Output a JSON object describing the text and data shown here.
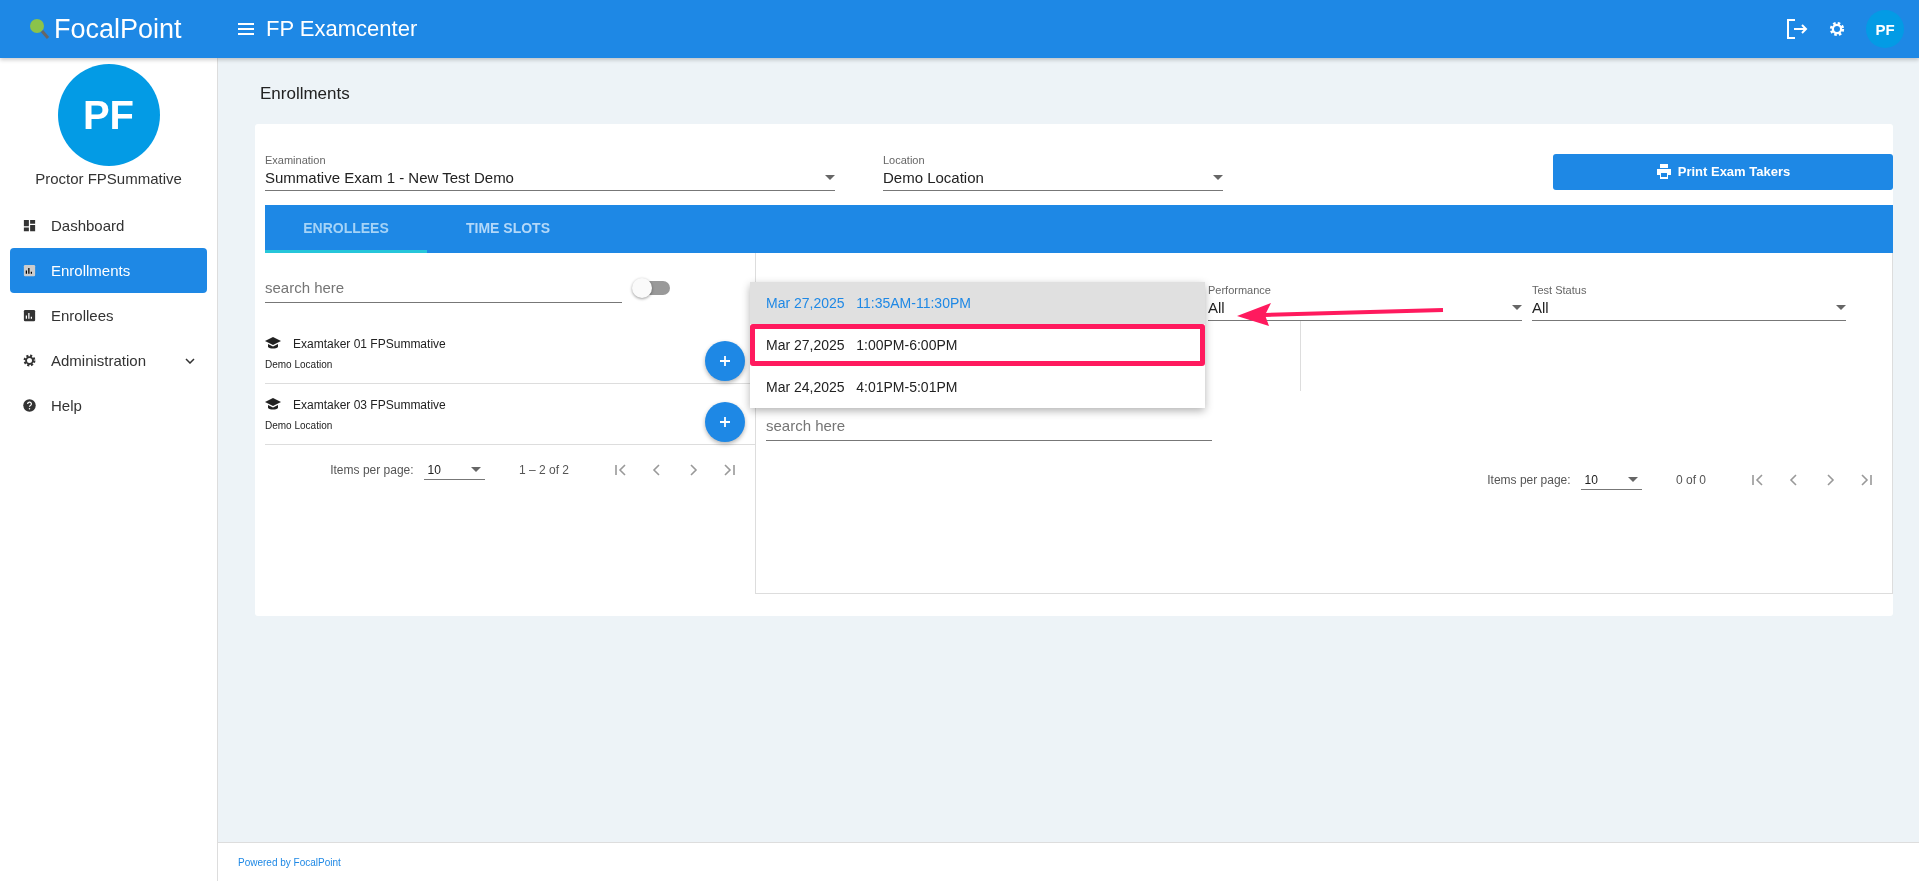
{
  "header": {
    "logo": "FocalPoint",
    "title": "FP Examcenter",
    "avatar": "PF"
  },
  "sidebar": {
    "avatar": "PF",
    "user": "Proctor FPSummative",
    "items": [
      {
        "label": "Dashboard",
        "selected": false,
        "expandable": false
      },
      {
        "label": "Enrollments",
        "selected": true,
        "expandable": false
      },
      {
        "label": "Enrollees",
        "selected": false,
        "expandable": false
      },
      {
        "label": "Administration",
        "selected": false,
        "expandable": true
      },
      {
        "label": "Help",
        "selected": false,
        "expandable": false
      }
    ]
  },
  "page_title": "Enrollments",
  "filters": [
    {
      "label": "Examination",
      "value": "Summative Exam 1 - New Test Demo"
    },
    {
      "label": "Location",
      "value": "Demo Location"
    }
  ],
  "print_button": "Print Exam Takers",
  "tabs": [
    {
      "label": "ENROLLEES",
      "selected": true
    },
    {
      "label": "TIME SLOTS",
      "selected": false
    }
  ],
  "enrollees": {
    "search": {
      "placeholder": "search here"
    },
    "toggle_on": false,
    "rows": [
      {
        "name": "Examtaker 01 FPSummative",
        "location": "Demo Location"
      },
      {
        "name": "Examtaker 03 FPSummative",
        "location": "Demo Location"
      }
    ],
    "paginator": {
      "label": "Items per page:",
      "size": "10",
      "range": "1 – 2 of 2"
    }
  },
  "time_slot_dropdown": {
    "options": [
      {
        "label": "Mar 27,2025   11:35AM-11:30PM",
        "selected": true,
        "highlighted": false
      },
      {
        "label": "Mar 27,2025   1:00PM-6:00PM",
        "selected": false,
        "highlighted": true
      },
      {
        "label": "Mar 24,2025   4:01PM-5:01PM",
        "selected": false,
        "highlighted": false
      }
    ]
  },
  "right_filters": [
    {
      "label": "Performance",
      "value": "All"
    },
    {
      "label": "Test Status",
      "value": "All"
    }
  ],
  "results": {
    "search": {
      "placeholder": "search here"
    },
    "paginator": {
      "label": "Items per page:",
      "size": "10",
      "range": "0 of 0"
    }
  },
  "footer": "Powered by FocalPoint"
}
